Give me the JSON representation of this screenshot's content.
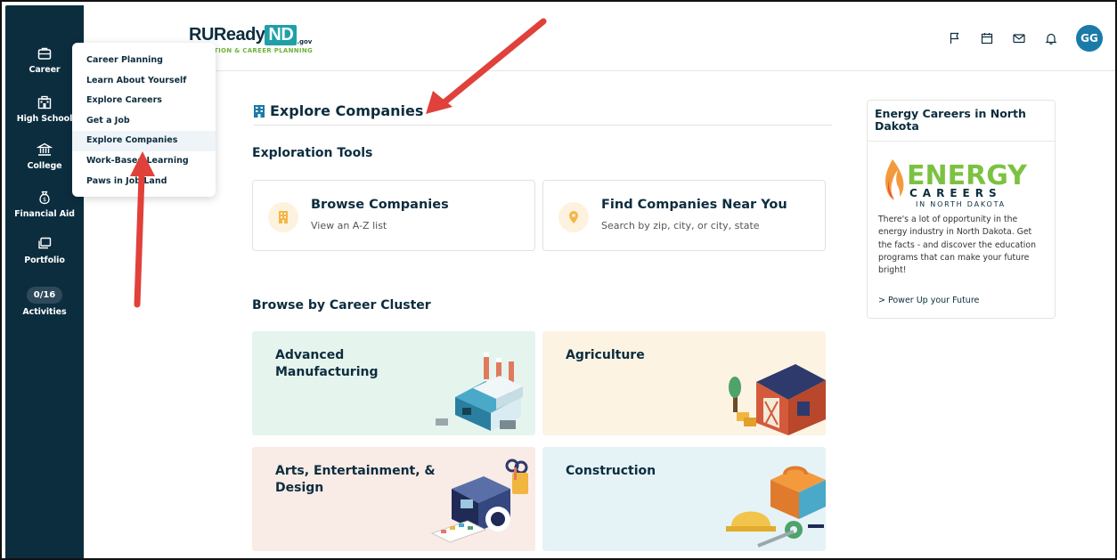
{
  "sidebar": {
    "items": [
      {
        "label": "Career",
        "icon": "briefcase-icon"
      },
      {
        "label": "High School",
        "icon": "school-icon"
      },
      {
        "label": "College",
        "icon": "college-icon"
      },
      {
        "label": "Financial Aid",
        "icon": "money-bag-icon"
      },
      {
        "label": "Portfolio",
        "icon": "portfolio-icon"
      },
      {
        "label": "Activities",
        "badge": "0/16"
      }
    ]
  },
  "header": {
    "logo_main": "RUReady",
    "logo_nd": "ND",
    "logo_gov": ".gov",
    "logo_tagline": "TION & CAREER PLANNING",
    "icons": [
      "flag-icon",
      "calendar-icon",
      "mail-icon",
      "bell-icon"
    ],
    "avatar_initials": "GG"
  },
  "dropdown": {
    "items": [
      "Career Planning",
      "Learn About Yourself",
      "Explore Careers",
      "Get a Job",
      "Explore Companies",
      "Work-Based Learning",
      "Paws in Job Land"
    ],
    "active_index": 4
  },
  "main": {
    "title": "Explore Companies",
    "tools_heading": "Exploration Tools",
    "tools": [
      {
        "title": "Browse Companies",
        "subtitle": "View an A-Z list",
        "icon": "building-icon"
      },
      {
        "title": "Find Companies Near You",
        "subtitle": "Search by zip, city, or city, state",
        "icon": "map-pin-icon"
      }
    ],
    "cluster_heading": "Browse by Career Cluster",
    "clusters": [
      {
        "label": "Advanced Manufacturing",
        "bg": "#e6f4ee"
      },
      {
        "label": "Agriculture",
        "bg": "#fdf3e3"
      },
      {
        "label": "Arts, Entertainment, & Design",
        "bg": "#f9ebe6"
      },
      {
        "label": "Construction",
        "bg": "#e5f3f7"
      }
    ]
  },
  "promo": {
    "title": "Energy Careers in North Dakota",
    "logo_word": "ENERGY",
    "logo_sub1": "CAREERS",
    "logo_sub2": "IN NORTH DAKOTA",
    "body": "There's a lot of opportunity in the energy industry in North Dakota. Get the facts - and discover the education programs that can make your future bright!",
    "link": "> Power Up your Future"
  },
  "colors": {
    "navy": "#0c2d3e",
    "teal": "#1fa0a8",
    "arrow": "#e0413a",
    "energy_green": "#7cc242"
  }
}
